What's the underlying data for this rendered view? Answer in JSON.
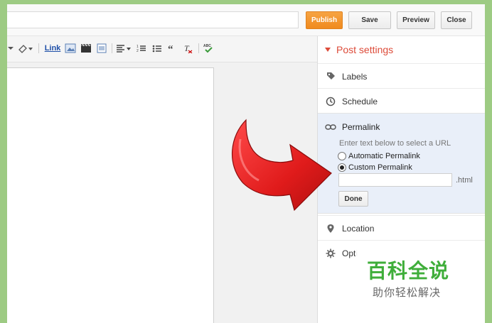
{
  "topbar": {
    "publish": "Publish",
    "save": "Save",
    "preview": "Preview",
    "close": "Close"
  },
  "toolbar": {
    "link": "Link",
    "icons": [
      "dropdown-icon",
      "eraser-icon",
      "image-icon",
      "video-icon",
      "jump-break-icon",
      "align-icon",
      "numbered-list-icon",
      "bullet-list-icon",
      "quote-icon",
      "clear-format-icon",
      "spellcheck-icon"
    ]
  },
  "sidebar": {
    "header": "Post settings",
    "labels": "Labels",
    "schedule": "Schedule",
    "permalink": {
      "title": "Permalink",
      "hint": "Enter text below to select a URL",
      "option_auto": "Automatic Permalink",
      "option_custom": "Custom Permalink",
      "selected": "Custom Permalink",
      "input_value": "",
      "suffix": ".html",
      "done": "Done"
    },
    "location": "Location",
    "options": "Opti"
  },
  "watermark": {
    "logo_text": "百科全说",
    "tagline": "助你轻松解决"
  },
  "colors": {
    "background": "#9dcb83",
    "publish": "#f08a1e",
    "accent_red": "#dd4b39",
    "arrow_red": "#e01b1b",
    "permalink_bg": "#e9eff9",
    "watermark_green": "#3fae3a"
  }
}
